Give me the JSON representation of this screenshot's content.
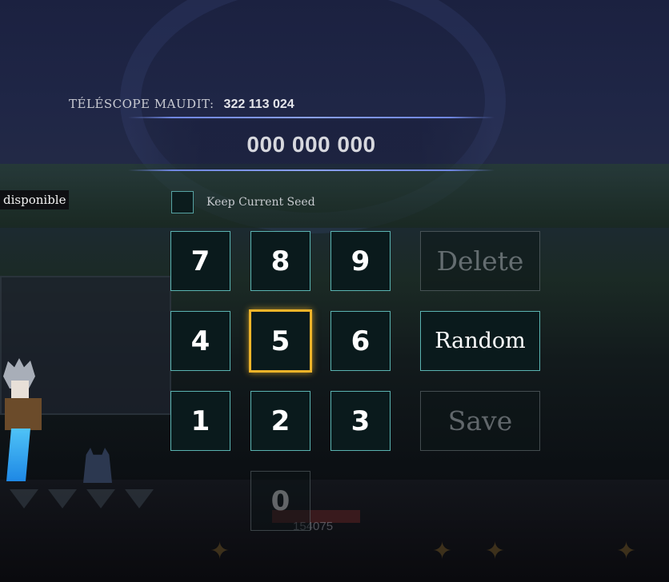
{
  "header": {
    "label": "TÉLÉSCOPE MAUDIT:",
    "current_seed": "322 113 024"
  },
  "seed_input": {
    "value": "000 000 000"
  },
  "status": {
    "text": "disponible"
  },
  "keep_seed": {
    "label": "Keep Current Seed",
    "checked": false
  },
  "keypad": {
    "keys": [
      "7",
      "8",
      "9",
      "4",
      "5",
      "6",
      "1",
      "2",
      "3",
      "0"
    ],
    "selected": "5",
    "disabled": [
      "0"
    ]
  },
  "actions": {
    "delete_label": "Delete",
    "random_label": "Random",
    "save_label": "Save"
  },
  "background": {
    "counter_text": "154075"
  },
  "colors": {
    "key_border": "#5ab3b1",
    "selected_border": "#f0b429",
    "rule": "#8aa0ef"
  }
}
